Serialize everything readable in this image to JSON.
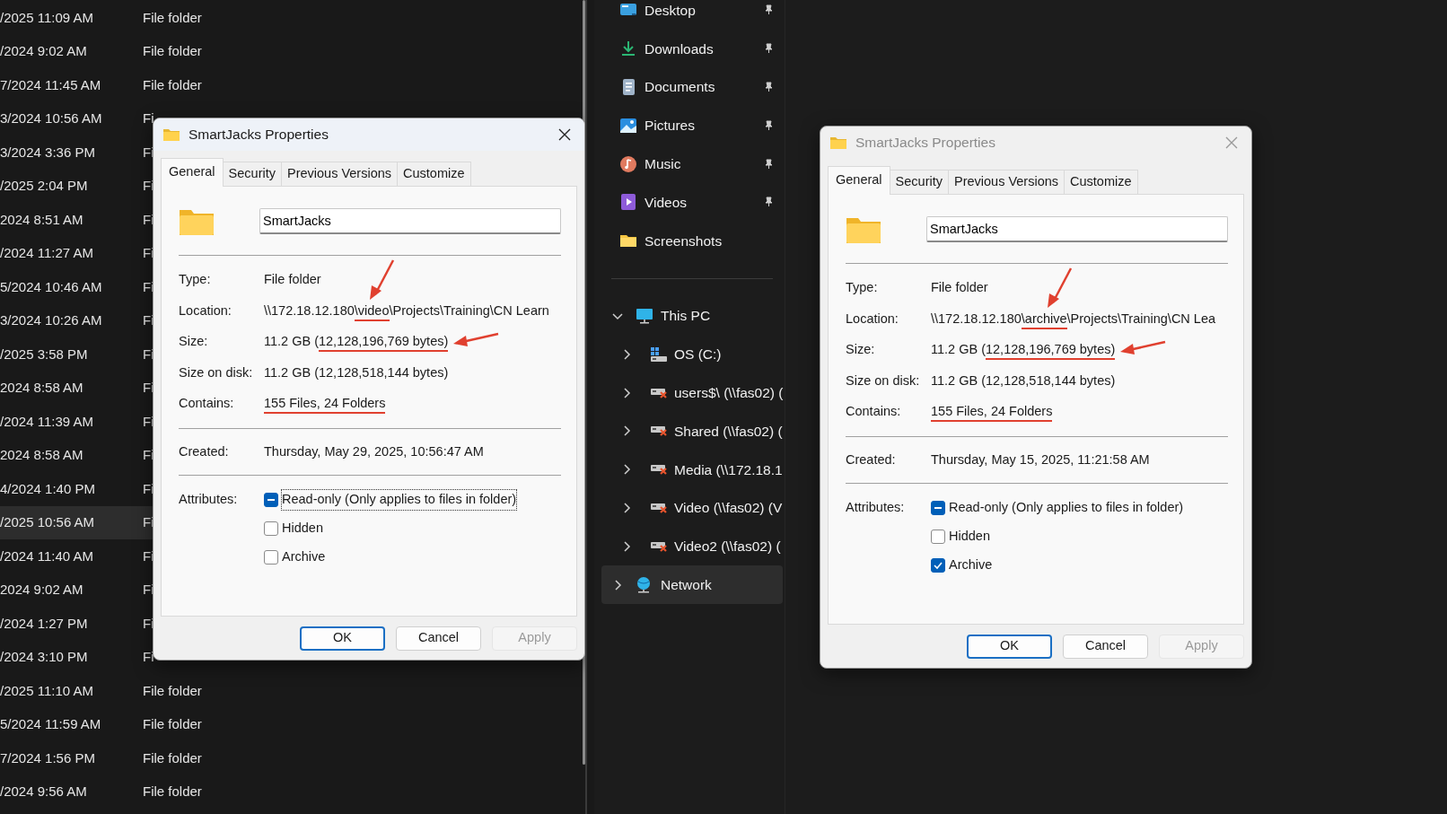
{
  "file_list": {
    "rows": [
      {
        "date": "/2025 11:09 AM",
        "type": "File folder",
        "selected": false
      },
      {
        "date": "/2024 9:02 AM",
        "type": "File folder",
        "selected": false
      },
      {
        "date": "7/2024 11:45 AM",
        "type": "File folder",
        "selected": false
      },
      {
        "date": "3/2024 10:56 AM",
        "type": "Fi",
        "selected": false
      },
      {
        "date": "3/2024 3:36 PM",
        "type": "Fi",
        "selected": false
      },
      {
        "date": "/2025 2:04 PM",
        "type": "Fi",
        "selected": false
      },
      {
        "date": "2024 8:51 AM",
        "type": "Fi",
        "selected": false
      },
      {
        "date": "/2024 11:27 AM",
        "type": "Fi",
        "selected": false
      },
      {
        "date": "5/2024 10:46 AM",
        "type": "Fi",
        "selected": false
      },
      {
        "date": "3/2024 10:26 AM",
        "type": "Fi",
        "selected": false
      },
      {
        "date": "/2025 3:58 PM",
        "type": "Fi",
        "selected": false
      },
      {
        "date": "2024 8:58 AM",
        "type": "Fi",
        "selected": false
      },
      {
        "date": "/2024 11:39 AM",
        "type": "Fi",
        "selected": false
      },
      {
        "date": "2024 8:58 AM",
        "type": "Fi",
        "selected": false
      },
      {
        "date": "4/2024 1:40 PM",
        "type": "Fi",
        "selected": false
      },
      {
        "date": "/2025 10:56 AM",
        "type": "Fi",
        "selected": true
      },
      {
        "date": "/2024 11:40 AM",
        "type": "Fi",
        "selected": false
      },
      {
        "date": "2024 9:02 AM",
        "type": "Fi",
        "selected": false
      },
      {
        "date": "/2024 1:27 PM",
        "type": "Fi",
        "selected": false
      },
      {
        "date": "/2024 3:10 PM",
        "type": "Fi",
        "selected": false
      },
      {
        "date": "/2025 11:10 AM",
        "type": "File folder",
        "selected": false
      },
      {
        "date": "5/2024 11:59 AM",
        "type": "File folder",
        "selected": false
      },
      {
        "date": "7/2024 1:56 PM",
        "type": "File folder",
        "selected": false
      },
      {
        "date": "/2024 9:56 AM",
        "type": "File folder",
        "selected": false
      }
    ]
  },
  "dialogs": [
    {
      "title": "SmartJacks Properties",
      "active": true,
      "tabs": [
        {
          "label": "General",
          "selected": true
        },
        {
          "label": "Security",
          "selected": false
        },
        {
          "label": "Previous Versions",
          "selected": false
        },
        {
          "label": "Customize",
          "selected": false
        }
      ],
      "name": "SmartJacks",
      "details": [
        {
          "label": "Type:",
          "value": [
            {
              "text": "File folder"
            }
          ]
        },
        {
          "label": "Location:",
          "value": [
            {
              "text": "\\\\172.18.12.180"
            },
            {
              "text": "\\video",
              "marked": true,
              "arrow": true
            },
            {
              "text": "\\Projects\\Training\\CN Learn"
            }
          ]
        },
        {
          "label": "Size:",
          "value": [
            {
              "text": "11.2 GB ("
            },
            {
              "text": "12,128,196,769 bytes)",
              "marked": true,
              "arrow": true
            }
          ]
        },
        {
          "label": "Size on disk:",
          "value": [
            {
              "text": "11.2 GB (12,128,518,144 bytes)"
            }
          ]
        },
        {
          "label": "Contains:",
          "value": [
            {
              "text": "155 Files, 24 Folders",
              "marked": true
            }
          ]
        }
      ],
      "created": {
        "label": "Created:",
        "value": "Thursday, May 29, 2025, 10:56:47 AM"
      },
      "attributes": {
        "label": "Attributes:",
        "items": [
          {
            "label": "Read-only (Only applies to files in folder)",
            "checked": false,
            "mixed": true,
            "focused": true
          },
          {
            "label": "Hidden",
            "checked": false,
            "mixed": false,
            "focused": false
          },
          {
            "label": "Archive",
            "checked": false,
            "mixed": false,
            "focused": false
          }
        ]
      },
      "buttons": [
        {
          "label": "OK",
          "default": true,
          "disabled": false
        },
        {
          "label": "Cancel",
          "default": false,
          "disabled": false
        },
        {
          "label": "Apply",
          "default": false,
          "disabled": true
        }
      ]
    },
    {
      "title": "SmartJacks Properties",
      "active": false,
      "tabs": [
        {
          "label": "General",
          "selected": true
        },
        {
          "label": "Security",
          "selected": false
        },
        {
          "label": "Previous Versions",
          "selected": false
        },
        {
          "label": "Customize",
          "selected": false
        }
      ],
      "name": "SmartJacks",
      "details": [
        {
          "label": "Type:",
          "value": [
            {
              "text": "File folder"
            }
          ]
        },
        {
          "label": "Location:",
          "value": [
            {
              "text": "\\\\172.18.12.180"
            },
            {
              "text": "\\archive",
              "marked": true,
              "arrow": true
            },
            {
              "text": "\\Projects\\Training\\CN Lea"
            }
          ]
        },
        {
          "label": "Size:",
          "value": [
            {
              "text": "11.2 GB ("
            },
            {
              "text": "12,128,196,769 bytes)",
              "marked": true,
              "arrow": true
            }
          ]
        },
        {
          "label": "Size on disk:",
          "value": [
            {
              "text": "11.2 GB (12,128,518,144 bytes)"
            }
          ]
        },
        {
          "label": "Contains:",
          "value": [
            {
              "text": "155 Files, 24 Folders",
              "marked": true
            }
          ]
        }
      ],
      "created": {
        "label": "Created:",
        "value": "Thursday, May 15, 2025, 11:21:58 AM"
      },
      "attributes": {
        "label": "Attributes:",
        "items": [
          {
            "label": "Read-only (Only applies to files in folder)",
            "checked": false,
            "mixed": true,
            "focused": false
          },
          {
            "label": "Hidden",
            "checked": false,
            "mixed": false,
            "focused": false
          },
          {
            "label": "Archive",
            "checked": true,
            "mixed": false,
            "focused": false
          }
        ]
      },
      "buttons": [
        {
          "label": "OK",
          "default": true,
          "disabled": false
        },
        {
          "label": "Cancel",
          "default": false,
          "disabled": false
        },
        {
          "label": "Apply",
          "default": false,
          "disabled": true
        }
      ]
    }
  ],
  "navigation": {
    "quick_access": [
      {
        "label": "Desktop",
        "kind": "desktop",
        "pinned": true
      },
      {
        "label": "Downloads",
        "kind": "downloads",
        "pinned": true
      },
      {
        "label": "Documents",
        "kind": "documents",
        "pinned": true
      },
      {
        "label": "Pictures",
        "kind": "pictures",
        "pinned": true
      },
      {
        "label": "Music",
        "kind": "music",
        "pinned": true
      },
      {
        "label": "Videos",
        "kind": "videos",
        "pinned": true
      },
      {
        "label": "Screenshots",
        "kind": "folder",
        "pinned": false
      }
    ],
    "tree": [
      {
        "label": "This PC",
        "kind": "pc",
        "expanded": true,
        "selected": false,
        "children": [
          {
            "label": "OS (C:)",
            "kind": "drive",
            "expanded": false,
            "selected": false
          },
          {
            "label": "users$\\ (\\\\fas02) (",
            "kind": "network-drive",
            "expanded": false,
            "selected": false
          },
          {
            "label": "Shared (\\\\fas02) (",
            "kind": "network-drive",
            "expanded": false,
            "selected": false
          },
          {
            "label": "Media (\\\\172.18.1",
            "kind": "network-drive",
            "expanded": false,
            "selected": false
          },
          {
            "label": "Video (\\\\fas02) (V",
            "kind": "network-drive",
            "expanded": false,
            "selected": false
          },
          {
            "label": "Video2 (\\\\fas02) (",
            "kind": "network-drive",
            "expanded": false,
            "selected": false
          }
        ]
      },
      {
        "label": "Network",
        "kind": "network",
        "expanded": false,
        "selected": true
      }
    ]
  }
}
